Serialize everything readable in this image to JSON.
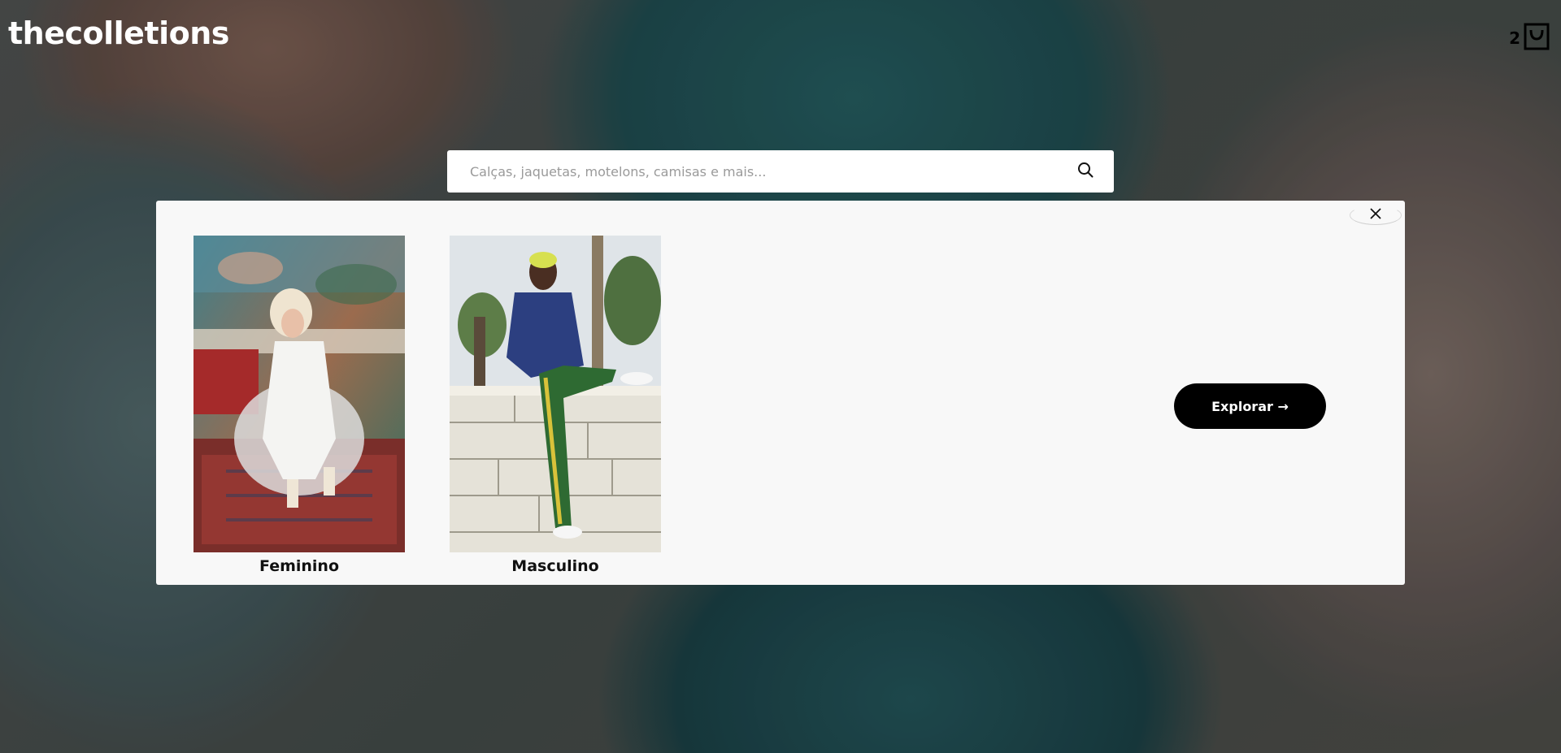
{
  "header": {
    "logo_text": "thecolletions",
    "cart_count": "2",
    "cart_icon": "shopping-bag-icon"
  },
  "search": {
    "placeholder": "Calças, jaquetas, motelons, camisas e mais...",
    "value": "",
    "icon": "search-icon"
  },
  "categories_modal": {
    "close_icon": "close-icon",
    "categories": [
      {
        "label": "Feminino"
      },
      {
        "label": "Masculino"
      }
    ],
    "explore_label": "Explorar →"
  }
}
